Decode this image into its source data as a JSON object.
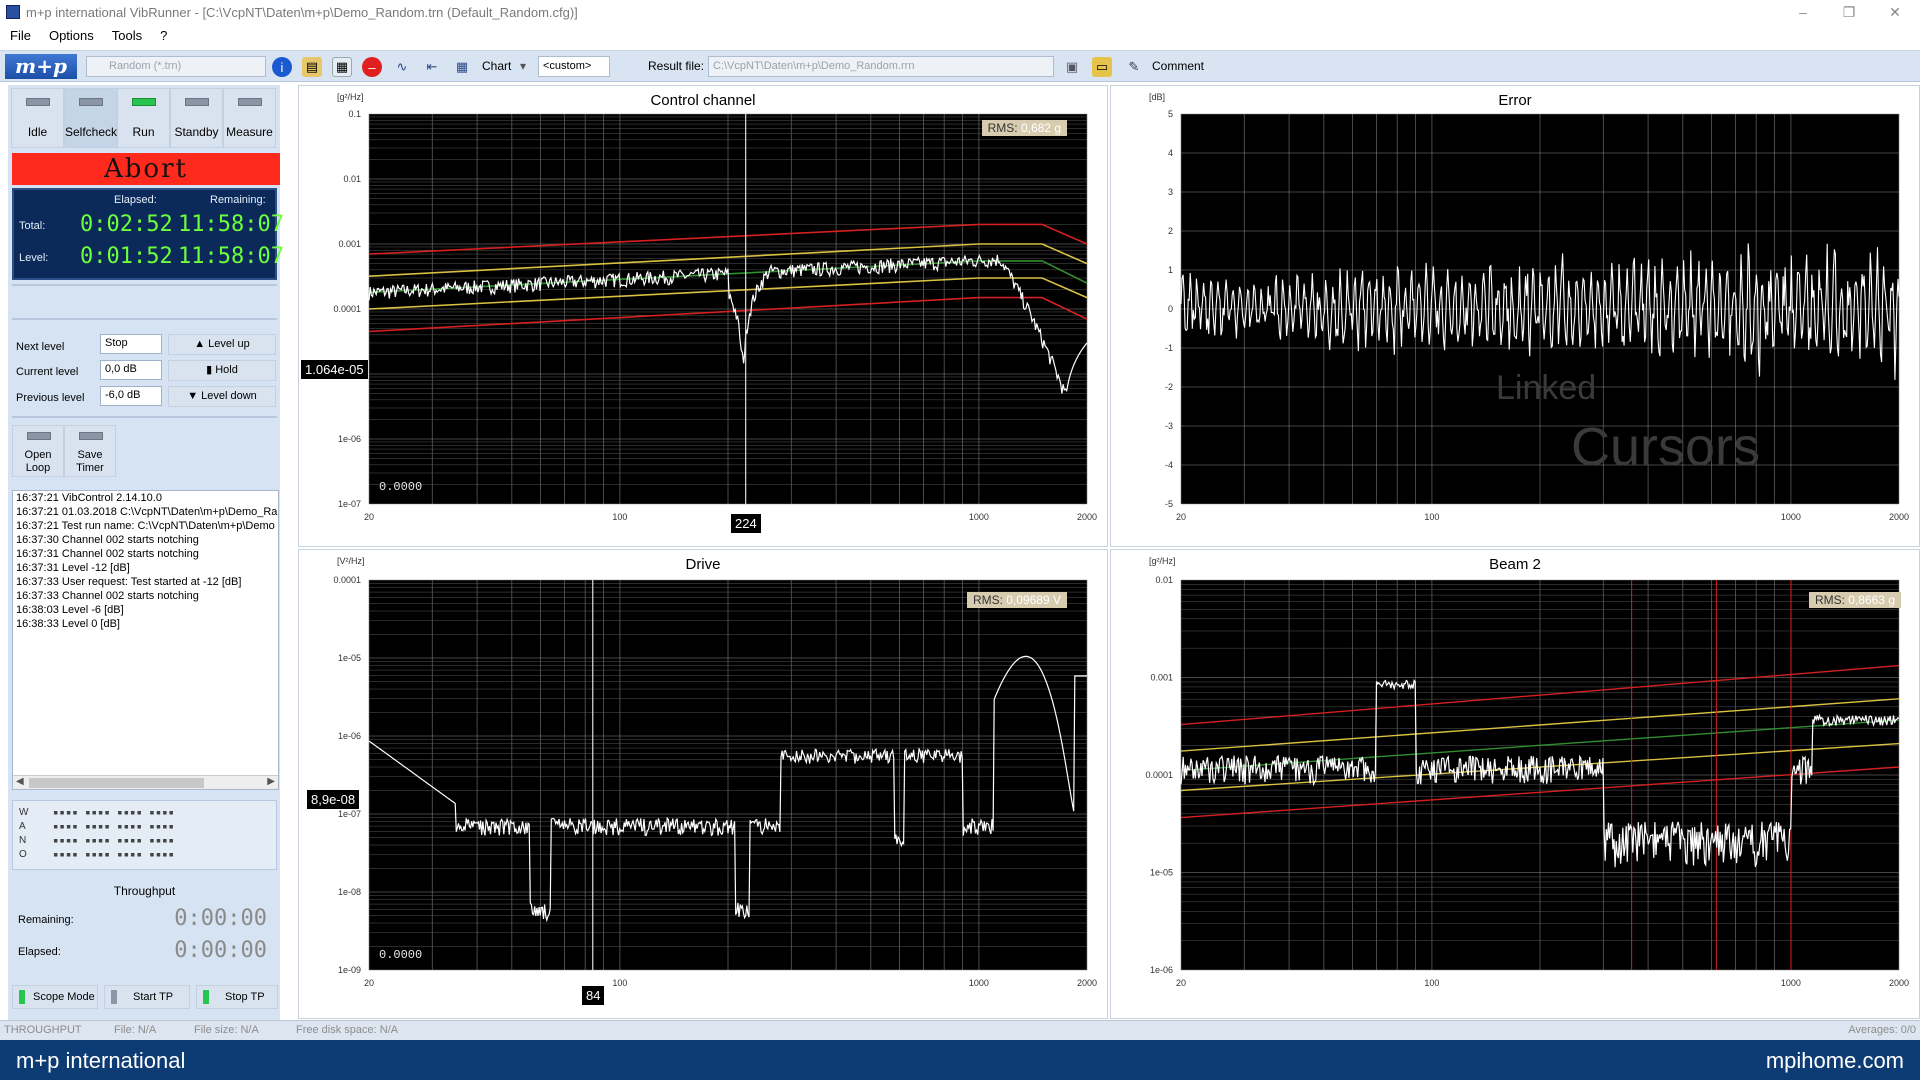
{
  "window": {
    "title": "m+p international VibRunner - [C:\\VcpNT\\Daten\\m+p\\Demo_Random.trn   (Default_Random.cfg)]",
    "controls": [
      "–",
      "❐",
      "✕"
    ]
  },
  "menu": [
    "File",
    "Options",
    "Tools",
    "?"
  ],
  "toolbar": {
    "logo": "m+p",
    "test_selector": "Random (*.trn)",
    "chart_label": "Chart",
    "custom_selector": "<custom>",
    "result_label": "Result file:",
    "result_path": "C:\\VcpNT\\Daten\\m+p\\Demo_Random.rrn",
    "comment_label": "Comment"
  },
  "modes": [
    {
      "label": "Idle",
      "led": "grey"
    },
    {
      "label": "Selfcheck",
      "led": "grey"
    },
    {
      "label": "Run",
      "led": "green"
    },
    {
      "label": "Standby",
      "led": "grey"
    },
    {
      "label": "Measure",
      "led": "grey"
    }
  ],
  "abort_label": "Abort",
  "time": {
    "elapsed_header": "Elapsed:",
    "remaining_header": "Remaining:",
    "total_label": "Total:",
    "total_elapsed": "0:02:52",
    "total_remaining": "11:58:07",
    "level_label": "Level:",
    "level_elapsed": "0:01:52",
    "level_remaining": "11:58:07"
  },
  "levels": {
    "next_label": "Next level",
    "next_value": "Stop",
    "current_label": "Current level",
    "current_value": "0,0  dB",
    "previous_label": "Previous level",
    "previous_value": "-6,0 dB",
    "level_up": "Level up",
    "hold": "Hold",
    "level_down": "Level down"
  },
  "loop_buttons": [
    {
      "label": "Open\nLoop"
    },
    {
      "label": "Save\nTimer"
    }
  ],
  "log": [
    "16:37:21 VibControl 2.14.10.0",
    "16:37:21 01.03.2018 C:\\VcpNT\\Daten\\m+p\\Demo_Ra",
    "16:37:21 Test run name: C:\\VcpNT\\Daten\\m+p\\Demo",
    "16:37:30 Channel 002 starts notching",
    "16:37:31 Channel 002 starts notching",
    "16:37:31 Level                     -12 [dB]",
    "16:37:33 User request: Test started at     -12 [dB]",
    "16:37:33 Channel 002 starts notching",
    "16:38:03 Level                      -6 [dB]",
    "16:38:33 Level                       0 [dB]"
  ],
  "led_letters": [
    "W",
    "A",
    "N",
    "O"
  ],
  "throughput": {
    "title": "Throughput",
    "remaining_label": "Remaining:",
    "remaining_value": "0:00:00",
    "elapsed_label": "Elapsed:",
    "elapsed_value": "0:00:00"
  },
  "bottom_buttons": [
    {
      "label": "Scope Mode",
      "led": "green"
    },
    {
      "label": "Start TP",
      "led": "grey"
    },
    {
      "label": "Stop TP",
      "led": "green"
    }
  ],
  "charts": {
    "control": {
      "title": "Control channel",
      "unit": "[g²/Hz]",
      "rms_label": "RMS:",
      "rms_value": "0,682 g",
      "y_ticks": [
        "0.1",
        "0.01",
        "0.001",
        "0.0001",
        "1e-05",
        "1e-06",
        "1e-07"
      ],
      "x_ticks": [
        "20",
        "100",
        "1000",
        "2000"
      ],
      "cursor_y": "1.064e-05",
      "cursor_x": "224",
      "readout": "0.0000"
    },
    "error": {
      "title": "Error",
      "unit": "[dB]",
      "y_ticks": [
        "5",
        "4",
        "3",
        "2",
        "1",
        "0",
        "-1",
        "-2",
        "-3",
        "-4",
        "-5"
      ],
      "x_ticks": [
        "20",
        "100",
        "1000",
        "2000"
      ],
      "watermark_1": "Linked",
      "watermark_2": "Cursors"
    },
    "drive": {
      "title": "Drive",
      "unit": "[V²/Hz]",
      "rms_label": "RMS:",
      "rms_value": "0,09689 V",
      "y_ticks": [
        "0.0001",
        "1e-05",
        "1e-06",
        "1e-07",
        "1e-08",
        "1e-09"
      ],
      "x_ticks": [
        "20",
        "100",
        "1000",
        "2000"
      ],
      "cursor_y": "8,9e-08",
      "cursor_x": "84",
      "readout": "0.0000"
    },
    "beam": {
      "title": "Beam 2",
      "unit": "[g²/Hz]",
      "rms_label": "RMS:",
      "rms_value": "0,8663 g",
      "y_ticks": [
        "0.01",
        "0.001",
        "0.0001",
        "1e-05",
        "1e-06"
      ],
      "x_ticks": [
        "20",
        "100",
        "1000",
        "2000"
      ]
    }
  },
  "status": {
    "throughput": "THROUGHPUT",
    "file": "File: N/A",
    "file_size": "File size: N/A",
    "disk": "Free disk space: N/A",
    "averages": "Averages: 0/0"
  },
  "footer": {
    "left": "m+p international",
    "right": "mpihome.com"
  },
  "colors": {
    "abort": "#ff2a1d",
    "timer_bg": "#0b2a5a",
    "timer_text": "#6dff3c",
    "footer": "#0d3b73",
    "tolerance_red": "#d42020",
    "tolerance_yellow": "#d8c040",
    "reference_green": "#2f8f2f"
  }
}
